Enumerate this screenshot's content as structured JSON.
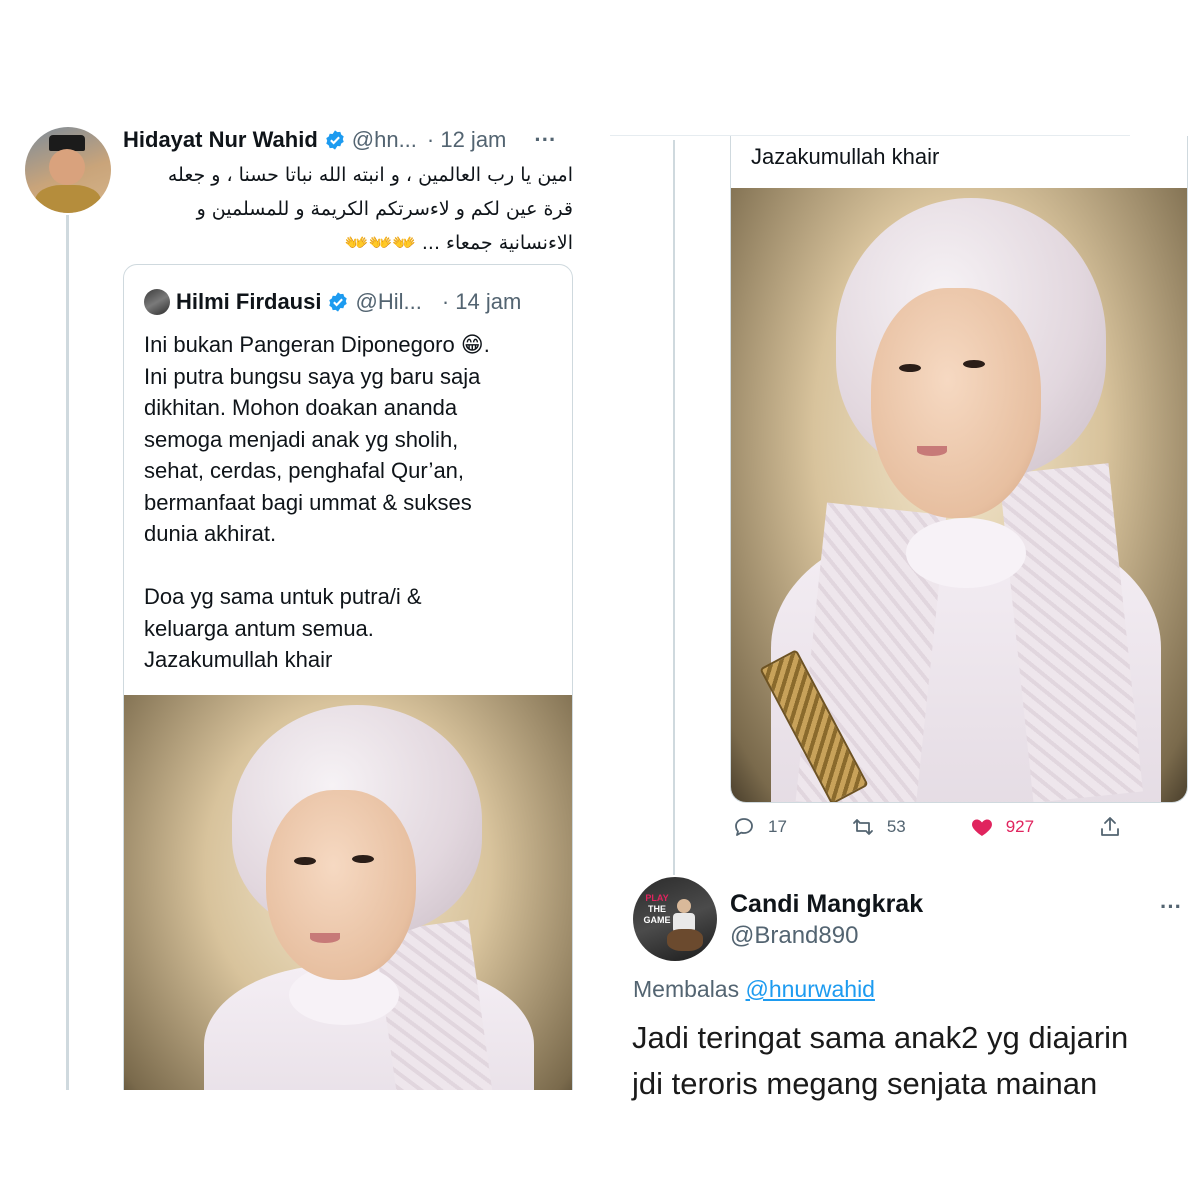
{
  "left_tweet": {
    "author_name": "Hidayat Nur Wahid",
    "author_handle": "@hn...",
    "time": "· 12 jam",
    "more": "···",
    "text_line1": "امين يا رب العالمين ، و انبته الله نباتا حسنا ، و جعله",
    "text_line2": "قرة عين لكم و لاءسرتكم الكريمة و للمسلمين و",
    "text_line3": "الاءنسانية جمعاء ...",
    "text_emoji": "👐👐👐"
  },
  "quoted_tweet": {
    "author_name": "Hilmi Firdausi",
    "author_handle": "@Hil...",
    "time": "· 14 jam",
    "lines": [
      "Ini bukan Pangeran Diponegoro 😁.",
      "Ini putra bungsu saya yg baru saja",
      "dikhitan. Mohon doakan ananda",
      "semoga menjadi anak yg sholih,",
      "sehat, cerdas, penghafal Qur’an,",
      "bermanfaat bagi ummat & sukses",
      "dunia akhirat.",
      "",
      "Doa yg sama untuk putra/i &",
      "keluarga antum semua.",
      "Jazakumullah khair"
    ]
  },
  "right_tweet": {
    "text": "Jazakumullah khair",
    "reply_count": "17",
    "retweet_count": "53",
    "like_count": "927"
  },
  "reply_tweet": {
    "author_name": "Candi Mangkrak",
    "author_handle": "@Brand890",
    "more": "···",
    "replying_prefix": "Membalas",
    "replying_to": "@hnurwahid",
    "avatar_text1": "PLAY",
    "avatar_text2": "THE",
    "avatar_text3": "GAME",
    "text_line1": "Jadi teringat sama anak2 yg diajarin",
    "text_line2": "jdi teroris megang senjata mainan"
  },
  "colors": {
    "verified": "#1d9bf0",
    "like": "#e0245e",
    "muted": "#536471",
    "thread_line": "#cfd9de"
  }
}
